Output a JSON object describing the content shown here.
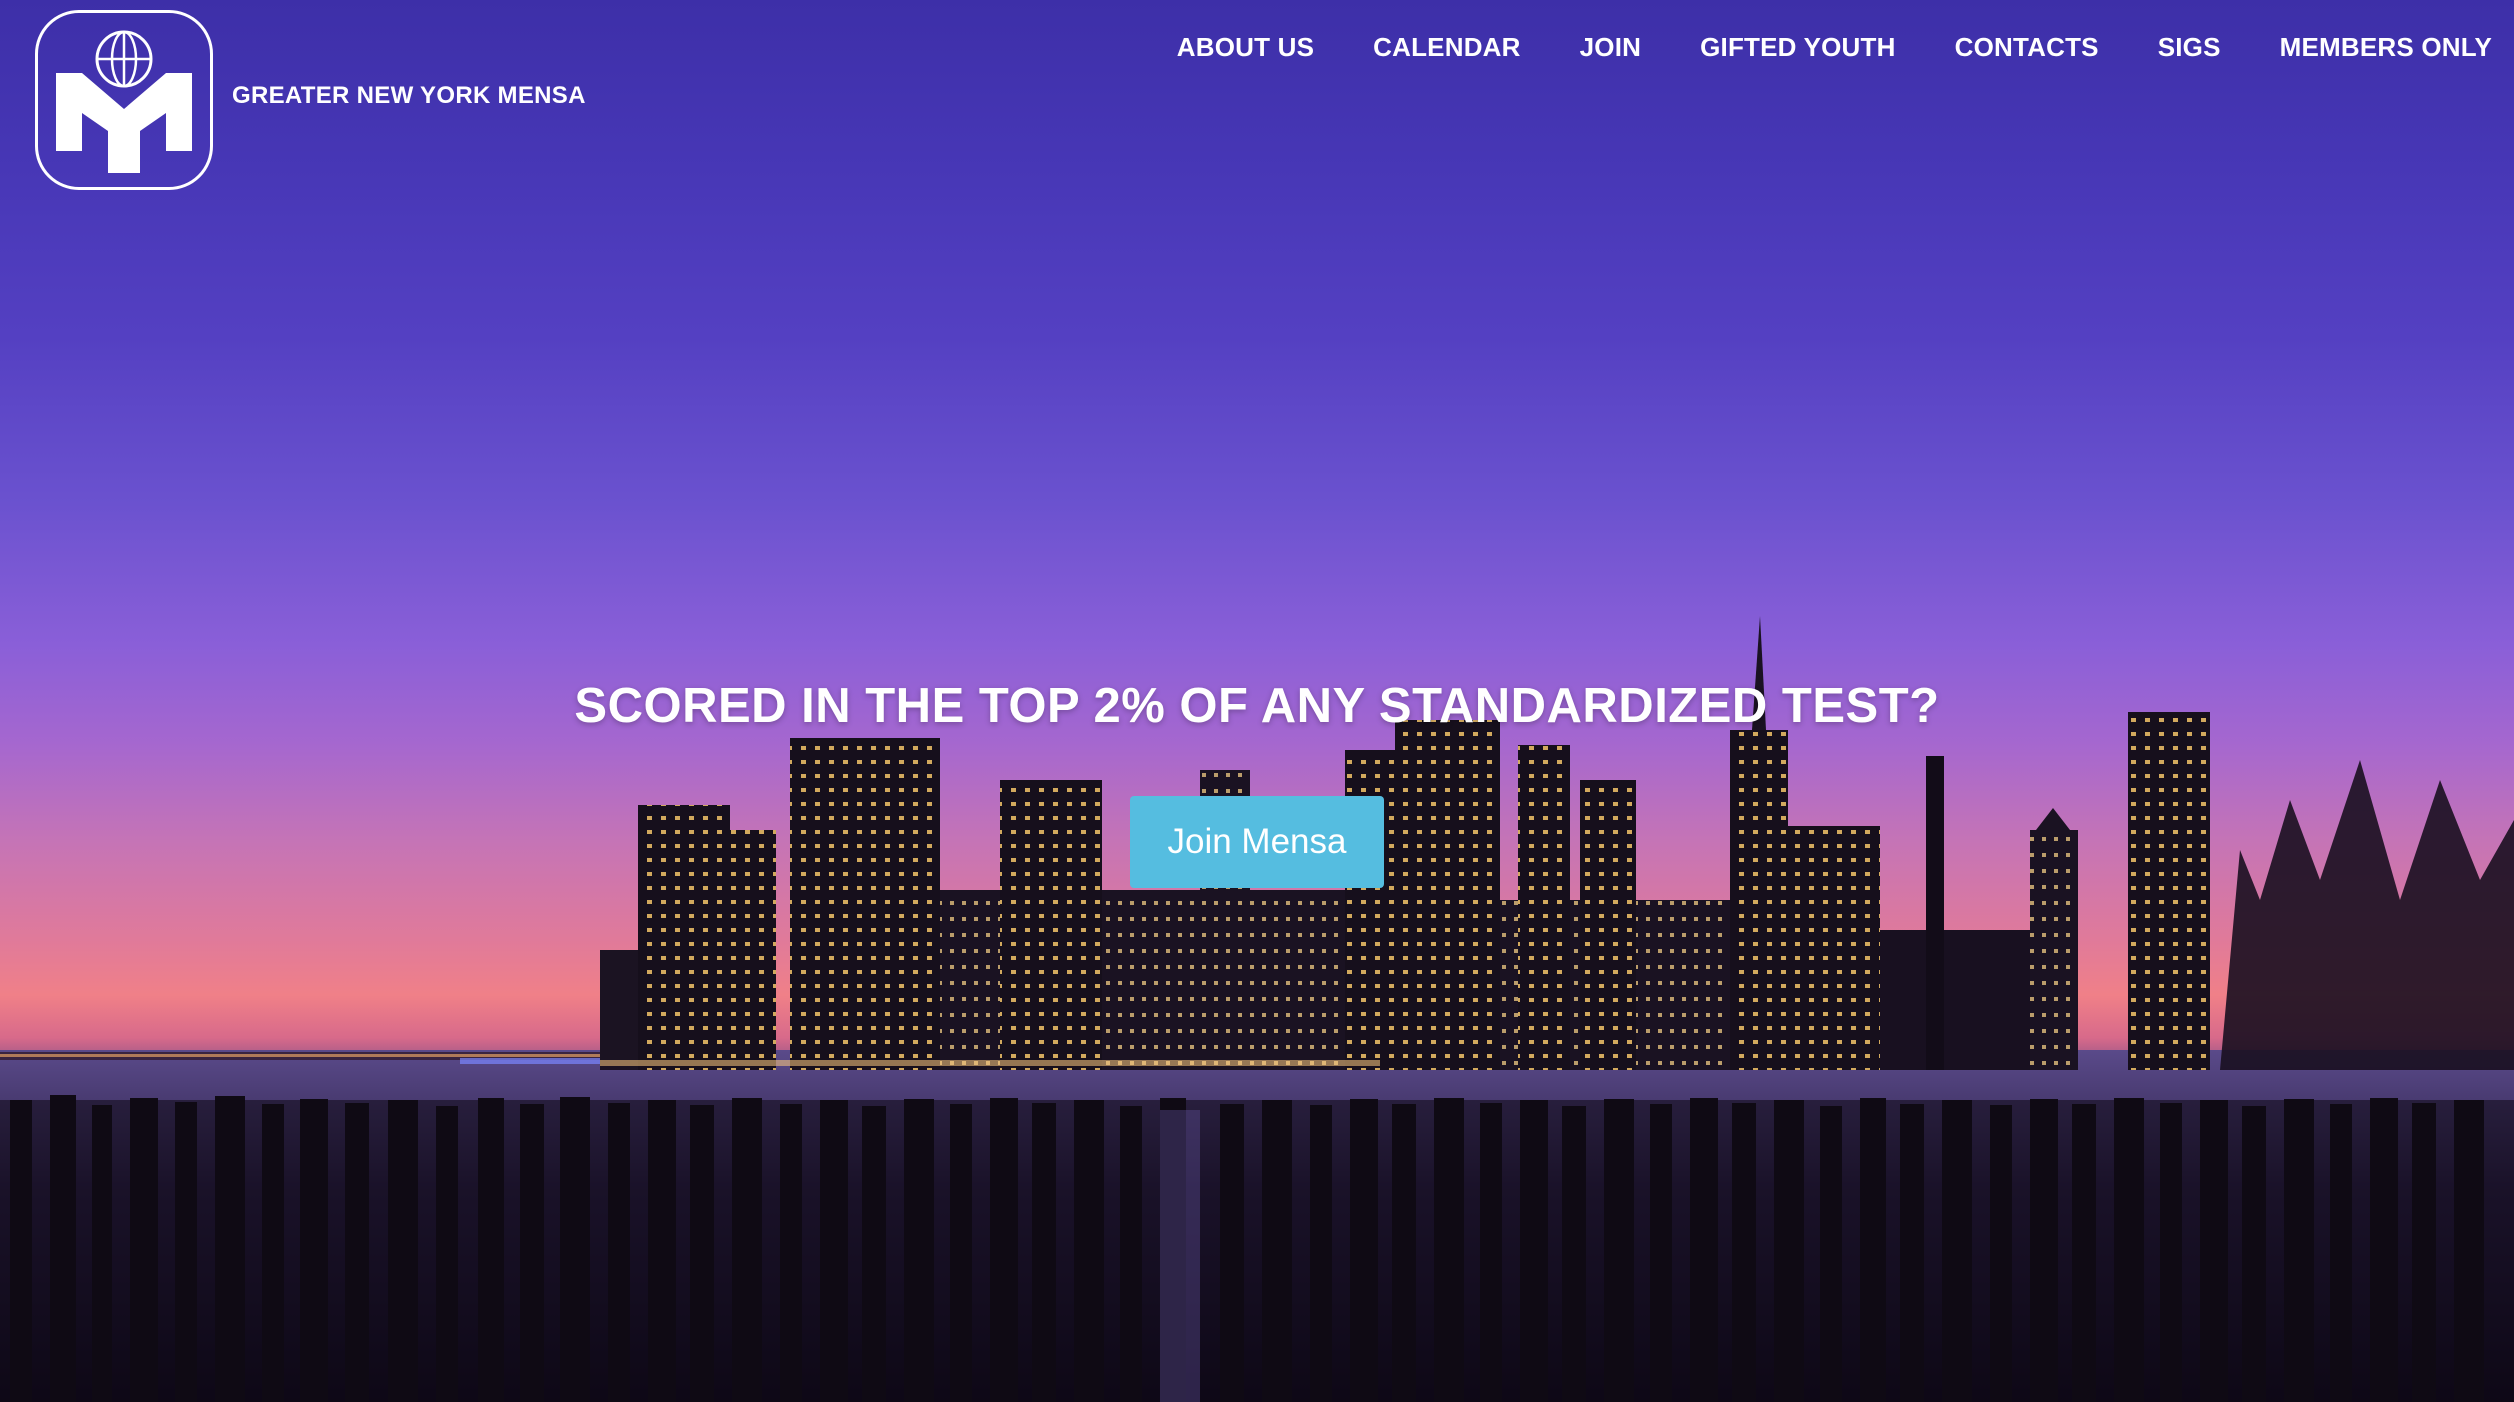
{
  "header": {
    "org_name": "GREATER NEW YORK MENSA",
    "logo_icon": "mensa-globe-m-logo"
  },
  "nav": {
    "items": [
      {
        "label": "ABOUT US"
      },
      {
        "label": "CALENDAR"
      },
      {
        "label": "JOIN"
      },
      {
        "label": "GIFTED YOUTH"
      },
      {
        "label": "CONTACTS"
      },
      {
        "label": "SIGS"
      },
      {
        "label": "MEMBERS ONLY"
      }
    ]
  },
  "hero": {
    "headline": "SCORED IN THE TOP 2% OF ANY STANDARDIZED TEST?",
    "cta_label": "Join Mensa",
    "background": "new-york-skyline-at-dusk-photo"
  },
  "colors": {
    "cta": "#55bde0",
    "sky_top": "#3d2fa8",
    "horizon": "#f08088",
    "text": "#ffffff"
  }
}
